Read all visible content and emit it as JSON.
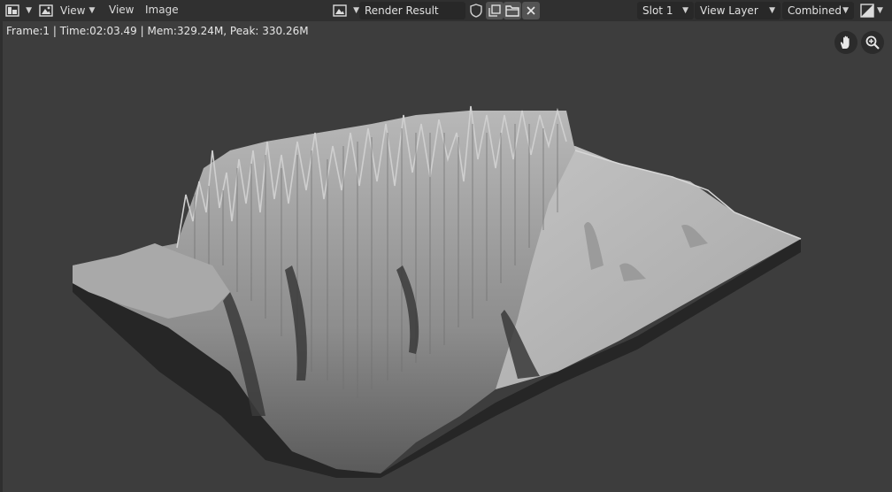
{
  "header": {
    "view_menu": "View",
    "view_item": "View",
    "image_item": "Image",
    "image_name": "Render Result",
    "slot": "Slot 1",
    "view_layer": "View Layer",
    "pass": "Combined"
  },
  "status": {
    "text": "Frame:1 | Time:02:03.49 | Mem:329.24M, Peak: 330.26M"
  },
  "icons": {
    "editor_type": "image-editor-icon",
    "mode": "view-mode-icon",
    "image_browse": "image-browse-icon",
    "fake_user": "shield-icon",
    "new_image": "duplicate-icon",
    "open_image": "folder-icon",
    "close": "close-icon",
    "display_channels": "display-channels-icon",
    "pan": "hand-icon",
    "zoom": "zoom-icon"
  },
  "colors": {
    "header_bg": "#303030",
    "canvas_bg": "#3d3d3d",
    "terrain_light": "#bdbdbd",
    "terrain_dark": "#2a2a2a"
  }
}
